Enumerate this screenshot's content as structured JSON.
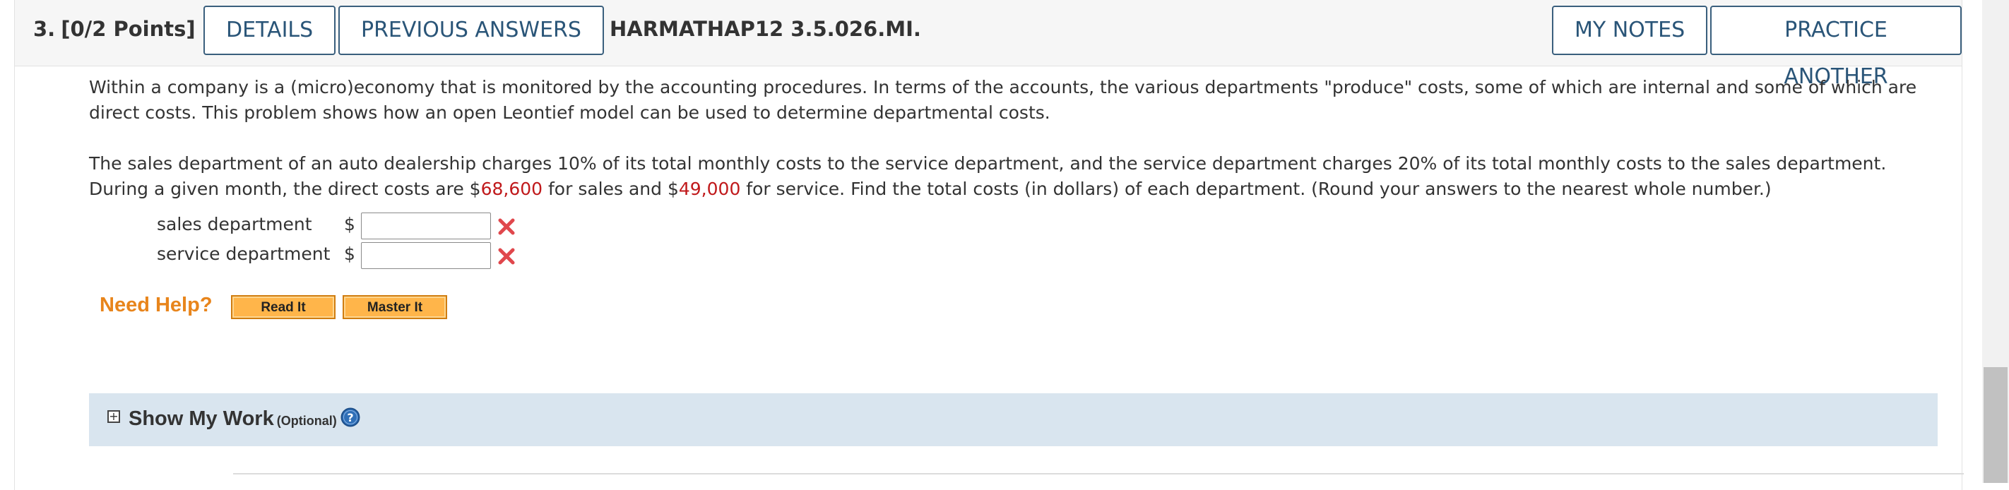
{
  "question": {
    "number": "3.",
    "points": "[0/2 Points]",
    "buttons": {
      "details": "DETAILS",
      "previous_answers": "PREVIOUS ANSWERS",
      "my_notes": "MY NOTES",
      "practice_another": "PRACTICE ANOTHER"
    },
    "code": "HARMATHAP12 3.5.026.MI."
  },
  "problem": {
    "paragraph1": "Within a company is a (micro)economy that is monitored by the accounting procedures. In terms of the accounts, the various departments \"produce\" costs, some of which are internal and some of which are direct costs. This problem shows how an open Leontief model can be used to determine departmental costs.",
    "paragraph2_a": "The sales department of an auto dealership charges 10% of its total monthly costs to the service department, and the service department charges 20% of its total monthly costs to the sales department. During a given month, the direct costs are $",
    "sales_cost": "68,600",
    "paragraph2_b": " for sales and $",
    "service_cost": "49,000",
    "paragraph2_c": " for service. Find the total costs (in dollars) of each department. (Round your answers to the nearest whole number.)"
  },
  "answers": [
    {
      "label": "sales department",
      "currency": "$",
      "value": "",
      "status": "incorrect"
    },
    {
      "label": "service department",
      "currency": "$",
      "value": "",
      "status": "incorrect"
    }
  ],
  "help": {
    "need_help": "Need Help?",
    "read_it": "Read It",
    "master_it": "Master It"
  },
  "show_my_work": {
    "toggle": "+",
    "title": "Show My Work",
    "optional": "(Optional)",
    "help_icon": "?"
  },
  "colors": {
    "button_border": "#3a5f7d",
    "button_text": "#2a5578",
    "highlight_value": "#c0191b",
    "need_help": "#e8851c",
    "help_button": "#ffb54a",
    "show_work_bg": "#d9e5ef",
    "error_mark": "#e0474c"
  },
  "icons": {
    "incorrect": "x-mark-icon",
    "expand": "plus-box-icon",
    "help": "question-circle-icon"
  }
}
